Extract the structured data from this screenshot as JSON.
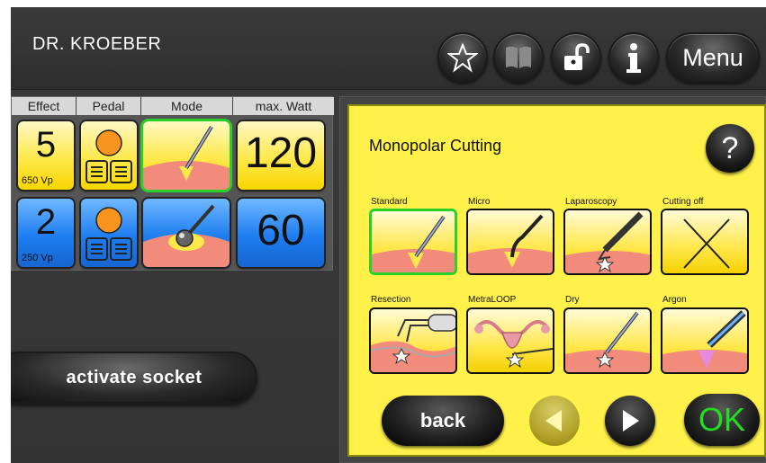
{
  "header": {
    "user_name": "DR. KROEBER",
    "menu_label": "Menu",
    "icons": [
      "star-icon",
      "book-icon",
      "unlock-icon",
      "info-icon"
    ]
  },
  "channels": {
    "headers": [
      "Effect",
      "Pedal",
      "Mode",
      "max. Watt"
    ],
    "rows": [
      {
        "effect": "5",
        "voltage": "650 Vp",
        "mode_icon": "cutting-electrode-icon",
        "max_watt": "120",
        "color": "#ffe84a"
      },
      {
        "effect": "2",
        "voltage": "250 Vp",
        "mode_icon": "ball-electrode-icon",
        "max_watt": "60",
        "color": "#1e7ef0"
      }
    ]
  },
  "activate_label": "activate socket",
  "mode_panel": {
    "title": "Monopolar Cutting",
    "help_label": "?",
    "modes": [
      {
        "label": "Standard",
        "icon": "standard-cut-icon",
        "selected": true
      },
      {
        "label": "Micro",
        "icon": "micro-cut-icon",
        "selected": false
      },
      {
        "label": "Laparoscopy",
        "icon": "laparoscopy-icon",
        "selected": false
      },
      {
        "label": "Cutting off",
        "icon": "cutting-off-icon",
        "selected": false
      },
      {
        "label": "Resection",
        "icon": "resection-icon",
        "selected": false
      },
      {
        "label": "MetraLOOP",
        "icon": "metraloop-icon",
        "selected": false
      },
      {
        "label": "Dry",
        "icon": "dry-cut-icon",
        "selected": false
      },
      {
        "label": "Argon",
        "icon": "argon-icon",
        "selected": false
      }
    ],
    "back_label": "back",
    "ok_label": "OK"
  }
}
